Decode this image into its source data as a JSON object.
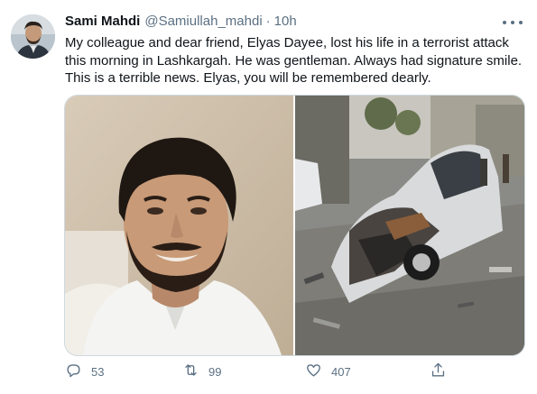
{
  "tweet": {
    "author": {
      "name": "Sami Mahdi",
      "handle": "@Samiullah_mahdi",
      "separator": "·",
      "time": "10h"
    },
    "text_lines": [
      "My colleague and dear friend, Elyas  Dayee, lost his life in a terrorist attack",
      "this morning in Lashkargah. He was gentleman. Always had signature smile.",
      "This is a terrible news. Elyas, you will be remembered dearly."
    ],
    "actions": {
      "reply_count": "53",
      "retweet_count": "99",
      "like_count": "407"
    },
    "colors": {
      "text": "#0f1419",
      "secondary": "#5b7083",
      "border": "#cfd9de"
    },
    "icons": [
      "more-icon",
      "reply-icon",
      "retweet-icon",
      "like-icon",
      "share-icon"
    ]
  }
}
